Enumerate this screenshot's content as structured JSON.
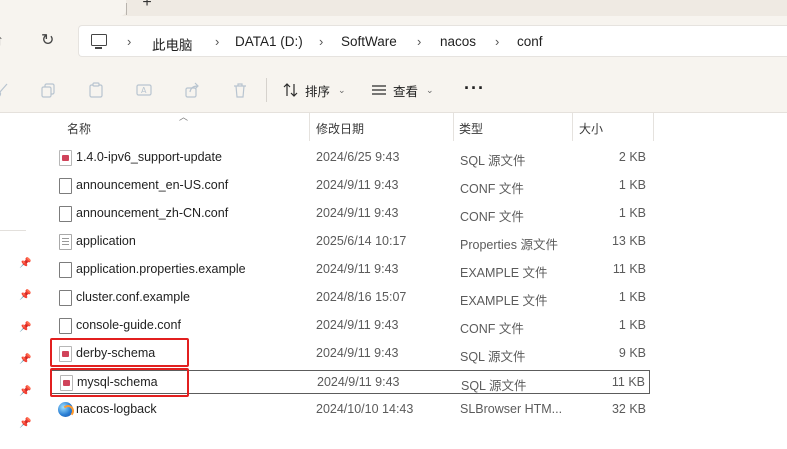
{
  "window": {
    "new_tab_glyph": "+"
  },
  "nav": {
    "up_glyph": "↑",
    "refresh_glyph": "↻",
    "breadcrumb": [
      "此电脑",
      "DATA1 (D:)",
      "SoftWare",
      "nacos",
      "conf"
    ],
    "chevron": "›",
    "pc_icon": "computer-icon"
  },
  "toolbar": {
    "sort_label": "排序",
    "view_label": "查看",
    "more_glyph": "···",
    "icons": [
      "cut-icon",
      "copy-icon",
      "paste-icon",
      "rename-icon",
      "share-icon",
      "delete-icon"
    ]
  },
  "columns": {
    "name": "名称",
    "date": "修改日期",
    "type": "类型",
    "size": "大小"
  },
  "files": [
    {
      "name": "1.4.0-ipv6_support-update",
      "date": "2024/6/25 9:43",
      "type": "SQL 源文件",
      "size": "2 KB",
      "icon": "sql-file-icon"
    },
    {
      "name": "announcement_en-US.conf",
      "date": "2024/9/11 9:43",
      "type": "CONF 文件",
      "size": "1 KB",
      "icon": "file-icon"
    },
    {
      "name": "announcement_zh-CN.conf",
      "date": "2024/9/11 9:43",
      "type": "CONF 文件",
      "size": "1 KB",
      "icon": "file-icon"
    },
    {
      "name": "application",
      "date": "2025/6/14 10:17",
      "type": "Properties 源文件",
      "size": "13 KB",
      "icon": "properties-file-icon"
    },
    {
      "name": "application.properties.example",
      "date": "2024/9/11 9:43",
      "type": "EXAMPLE 文件",
      "size": "11 KB",
      "icon": "file-icon"
    },
    {
      "name": "cluster.conf.example",
      "date": "2024/8/16 15:07",
      "type": "EXAMPLE 文件",
      "size": "1 KB",
      "icon": "file-icon"
    },
    {
      "name": "console-guide.conf",
      "date": "2024/9/11 9:43",
      "type": "CONF 文件",
      "size": "1 KB",
      "icon": "file-icon"
    },
    {
      "name": "derby-schema",
      "date": "2024/9/11 9:43",
      "type": "SQL 源文件",
      "size": "9 KB",
      "icon": "sql-file-icon"
    },
    {
      "name": "mysql-schema",
      "date": "2024/9/11 9:43",
      "type": "SQL 源文件",
      "size": "11 KB",
      "icon": "sql-file-icon"
    },
    {
      "name": "nacos-logback",
      "date": "2024/10/10 14:43",
      "type": "SLBrowser HTM...",
      "size": "32 KB",
      "icon": "browser-html-icon"
    }
  ],
  "pin_glyph": "📌",
  "colors": {
    "highlight": "#e21f1f",
    "chrome": "#f7f4ef",
    "sql_icon": "#d0435a"
  }
}
